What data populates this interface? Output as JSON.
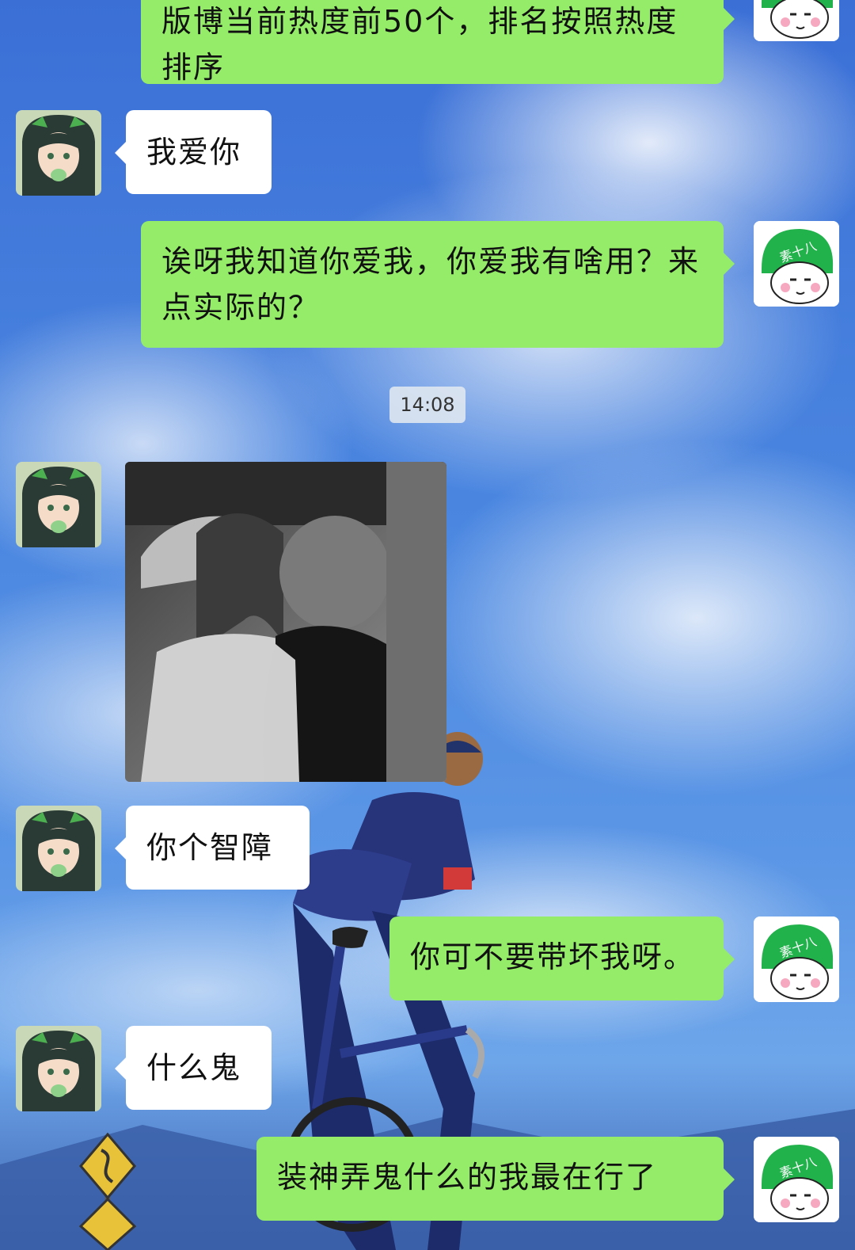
{
  "chat": {
    "timestamp": "14:08",
    "messages": [
      {
        "side": "right",
        "text": "版博当前热度前50个，排名按照热度排序"
      },
      {
        "side": "left",
        "text": "我爱你"
      },
      {
        "side": "right",
        "text": "诶呀我知道你爱我，你爱我有啥用？来点实际的？"
      },
      {
        "side": "left",
        "type": "image",
        "content": "black-and-white photo of two children kissing"
      },
      {
        "side": "left",
        "text": "你个智障"
      },
      {
        "side": "right",
        "text": "你可不要带坏我呀。"
      },
      {
        "side": "left",
        "text": "什么鬼"
      },
      {
        "side": "right",
        "text": "装神弄鬼什么的我最在行了"
      }
    ]
  },
  "avatars": {
    "left": {
      "icon": "anime-girl-avatar"
    },
    "right": {
      "icon": "green-helmet-meme-avatar",
      "helmet_text": "素十八"
    }
  },
  "colors": {
    "right_bubble": "#95ec69",
    "left_bubble": "#ffffff",
    "time_pill": "#e1e8f0"
  }
}
